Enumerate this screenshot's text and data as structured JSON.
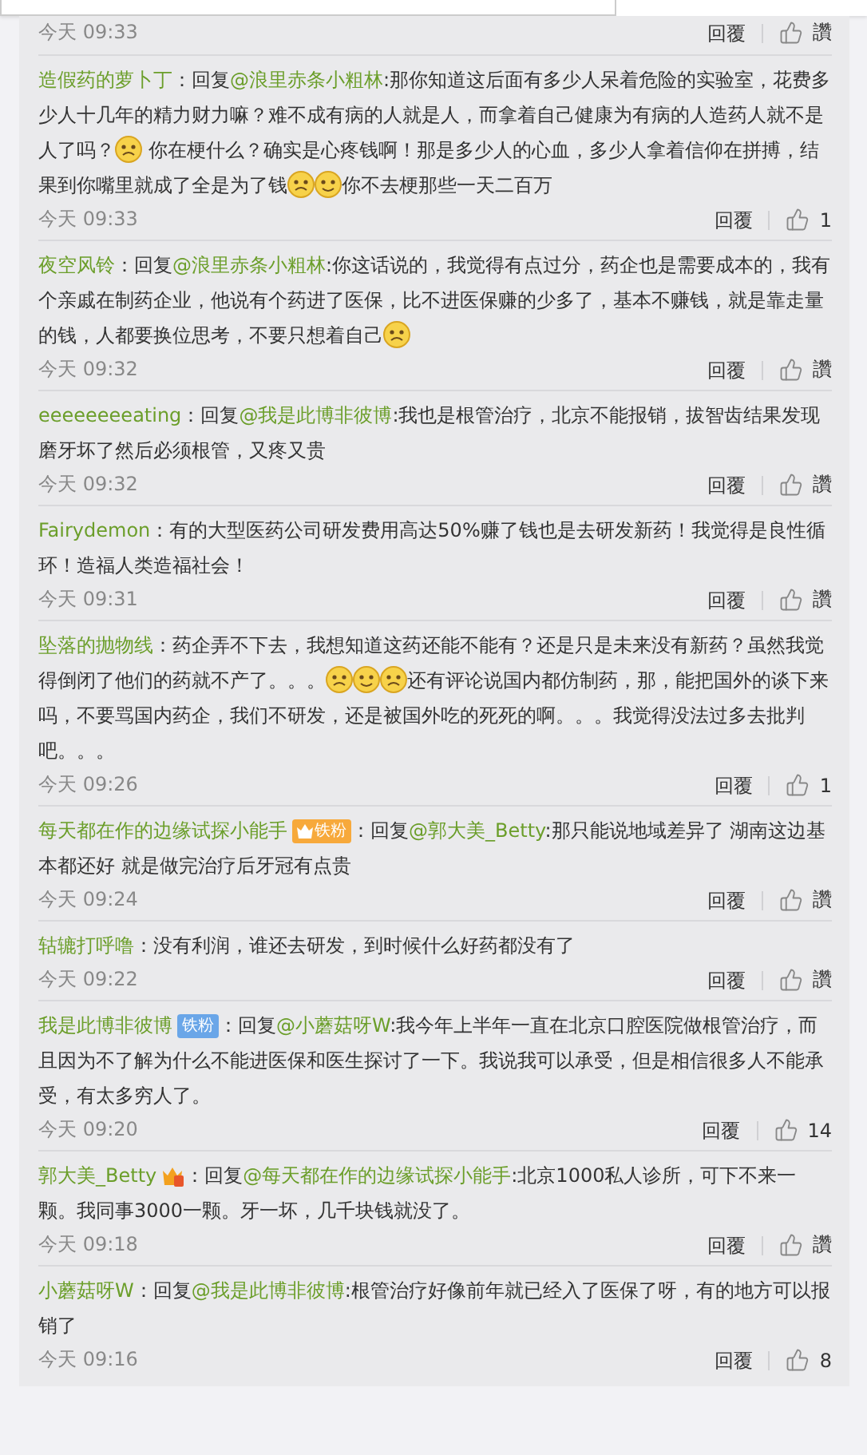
{
  "comments": [
    {
      "time": "今天 09:33",
      "reply": "回覆",
      "likes": "讚"
    },
    {
      "user": "造假药的萝卜丁",
      "parts": [
        {
          "kind": "text",
          "text": "：回复"
        },
        {
          "kind": "mention",
          "text": "@浪里赤条小粗林"
        },
        {
          "kind": "text",
          "text": ":那你知道这后面有多少人呆着危险的实验室，花费多少人十几年的精力财力嘛？难不成有病的人就是人，而拿着自己健康为有病的人造药人就不是人了吗？"
        },
        {
          "kind": "emoji"
        },
        {
          "kind": "text",
          "text": " 你在梗什么？确实是心疼钱啊！那是多少人的心血，多少人拿着信仰在拼搏，结果到你嘴里就成了全是为了钱"
        },
        {
          "kind": "emoji"
        },
        {
          "kind": "emoji"
        },
        {
          "kind": "text",
          "text": "你不去梗那些一天二百万"
        }
      ],
      "time": "今天 09:33",
      "reply": "回覆",
      "likes": "1"
    },
    {
      "user": "夜空风铃",
      "parts": [
        {
          "kind": "text",
          "text": "：回复"
        },
        {
          "kind": "mention",
          "text": "@浪里赤条小粗林"
        },
        {
          "kind": "text",
          "text": ":你这话说的，我觉得有点过分，药企也是需要成本的，我有个亲戚在制药企业，他说有个药进了医保，比不进医保赚的少多了，基本不赚钱，就是靠走量的钱，人都要换位思考，不要只想着自己"
        },
        {
          "kind": "emoji"
        }
      ],
      "time": "今天 09:32",
      "reply": "回覆",
      "likes": "讚"
    },
    {
      "user": "eeeeeeeeating",
      "parts": [
        {
          "kind": "text",
          "text": "：回复"
        },
        {
          "kind": "mention",
          "text": "@我是此博非彼博"
        },
        {
          "kind": "text",
          "text": ":我也是根管治疗，北京不能报销，拔智齿结果发现磨牙坏了然后必须根管，又疼又贵"
        }
      ],
      "time": "今天 09:32",
      "reply": "回覆",
      "likes": "讚"
    },
    {
      "user": "Fairydemon",
      "parts": [
        {
          "kind": "text",
          "text": "：有的大型医药公司研发费用高达50%赚了钱也是去研发新药！我觉得是良性循环！造福人类造福社会！"
        }
      ],
      "time": "今天 09:31",
      "reply": "回覆",
      "likes": "讚"
    },
    {
      "user": "坠落的抛物线",
      "parts": [
        {
          "kind": "text",
          "text": "：药企弄不下去，我想知道这药还能不能有？还是只是未来没有新药？虽然我觉得倒闭了他们的药就不产了。。。"
        },
        {
          "kind": "emoji"
        },
        {
          "kind": "emoji"
        },
        {
          "kind": "emoji"
        },
        {
          "kind": "text",
          "text": "还有评论说国内都仿制药，那，能把国外的谈下来吗，不要骂国内药企，我们不研发，还是被国外吃的死死的啊。。。我觉得没法过多去批判吧。。。"
        }
      ],
      "time": "今天 09:26",
      "reply": "回覆",
      "likes": "1"
    },
    {
      "user": "每天都在作的边缘试探小能手",
      "badge": {
        "kind": "level",
        "text": "铁粉"
      },
      "parts": [
        {
          "kind": "text",
          "text": "：回复"
        },
        {
          "kind": "mention",
          "text": "@郭大美_Betty"
        },
        {
          "kind": "text",
          "text": ":那只能说地域差异了 湖南这边基本都还好 就是做完治疗后牙冠有点贵"
        }
      ],
      "time": "今天 09:24",
      "reply": "回覆",
      "likes": "讚"
    },
    {
      "user": "轱辘打呼噜",
      "parts": [
        {
          "kind": "text",
          "text": "：没有利润，谁还去研发，到时候什么好药都没有了"
        }
      ],
      "time": "今天 09:22",
      "reply": "回覆",
      "likes": "讚"
    },
    {
      "user": "我是此博非彼博",
      "badge": {
        "kind": "plain",
        "text": "铁粉"
      },
      "parts": [
        {
          "kind": "text",
          "text": "：回复"
        },
        {
          "kind": "mention",
          "text": "@小蘑菇呀W"
        },
        {
          "kind": "text",
          "text": ":我今年上半年一直在北京口腔医院做根管治疗，而且因为不了解为什么不能进医保和医生探讨了一下。我说我可以承受，但是相信很多人不能承受，有太多穷人了。"
        }
      ],
      "time": "今天 09:20",
      "reply": "回覆",
      "likes": "14"
    },
    {
      "user": "郭大美_Betty",
      "badge": {
        "kind": "icon"
      },
      "parts": [
        {
          "kind": "text",
          "text": "：回复"
        },
        {
          "kind": "mention",
          "text": "@每天都在作的边缘试探小能手"
        },
        {
          "kind": "text",
          "text": ":北京1000私人诊所，可下不来一颗。我同事3000一颗。牙一坏，几千块钱就没了。"
        }
      ],
      "time": "今天 09:18",
      "reply": "回覆",
      "likes": "讚"
    },
    {
      "user": "小蘑菇呀W",
      "parts": [
        {
          "kind": "text",
          "text": "：回复"
        },
        {
          "kind": "mention",
          "text": "@我是此博非彼博"
        },
        {
          "kind": "text",
          "text": ":根管治疗好像前年就已经入了医保了呀，有的地方可以报销了"
        }
      ],
      "time": "今天 09:16",
      "reply": "回覆",
      "likes": "8"
    }
  ]
}
